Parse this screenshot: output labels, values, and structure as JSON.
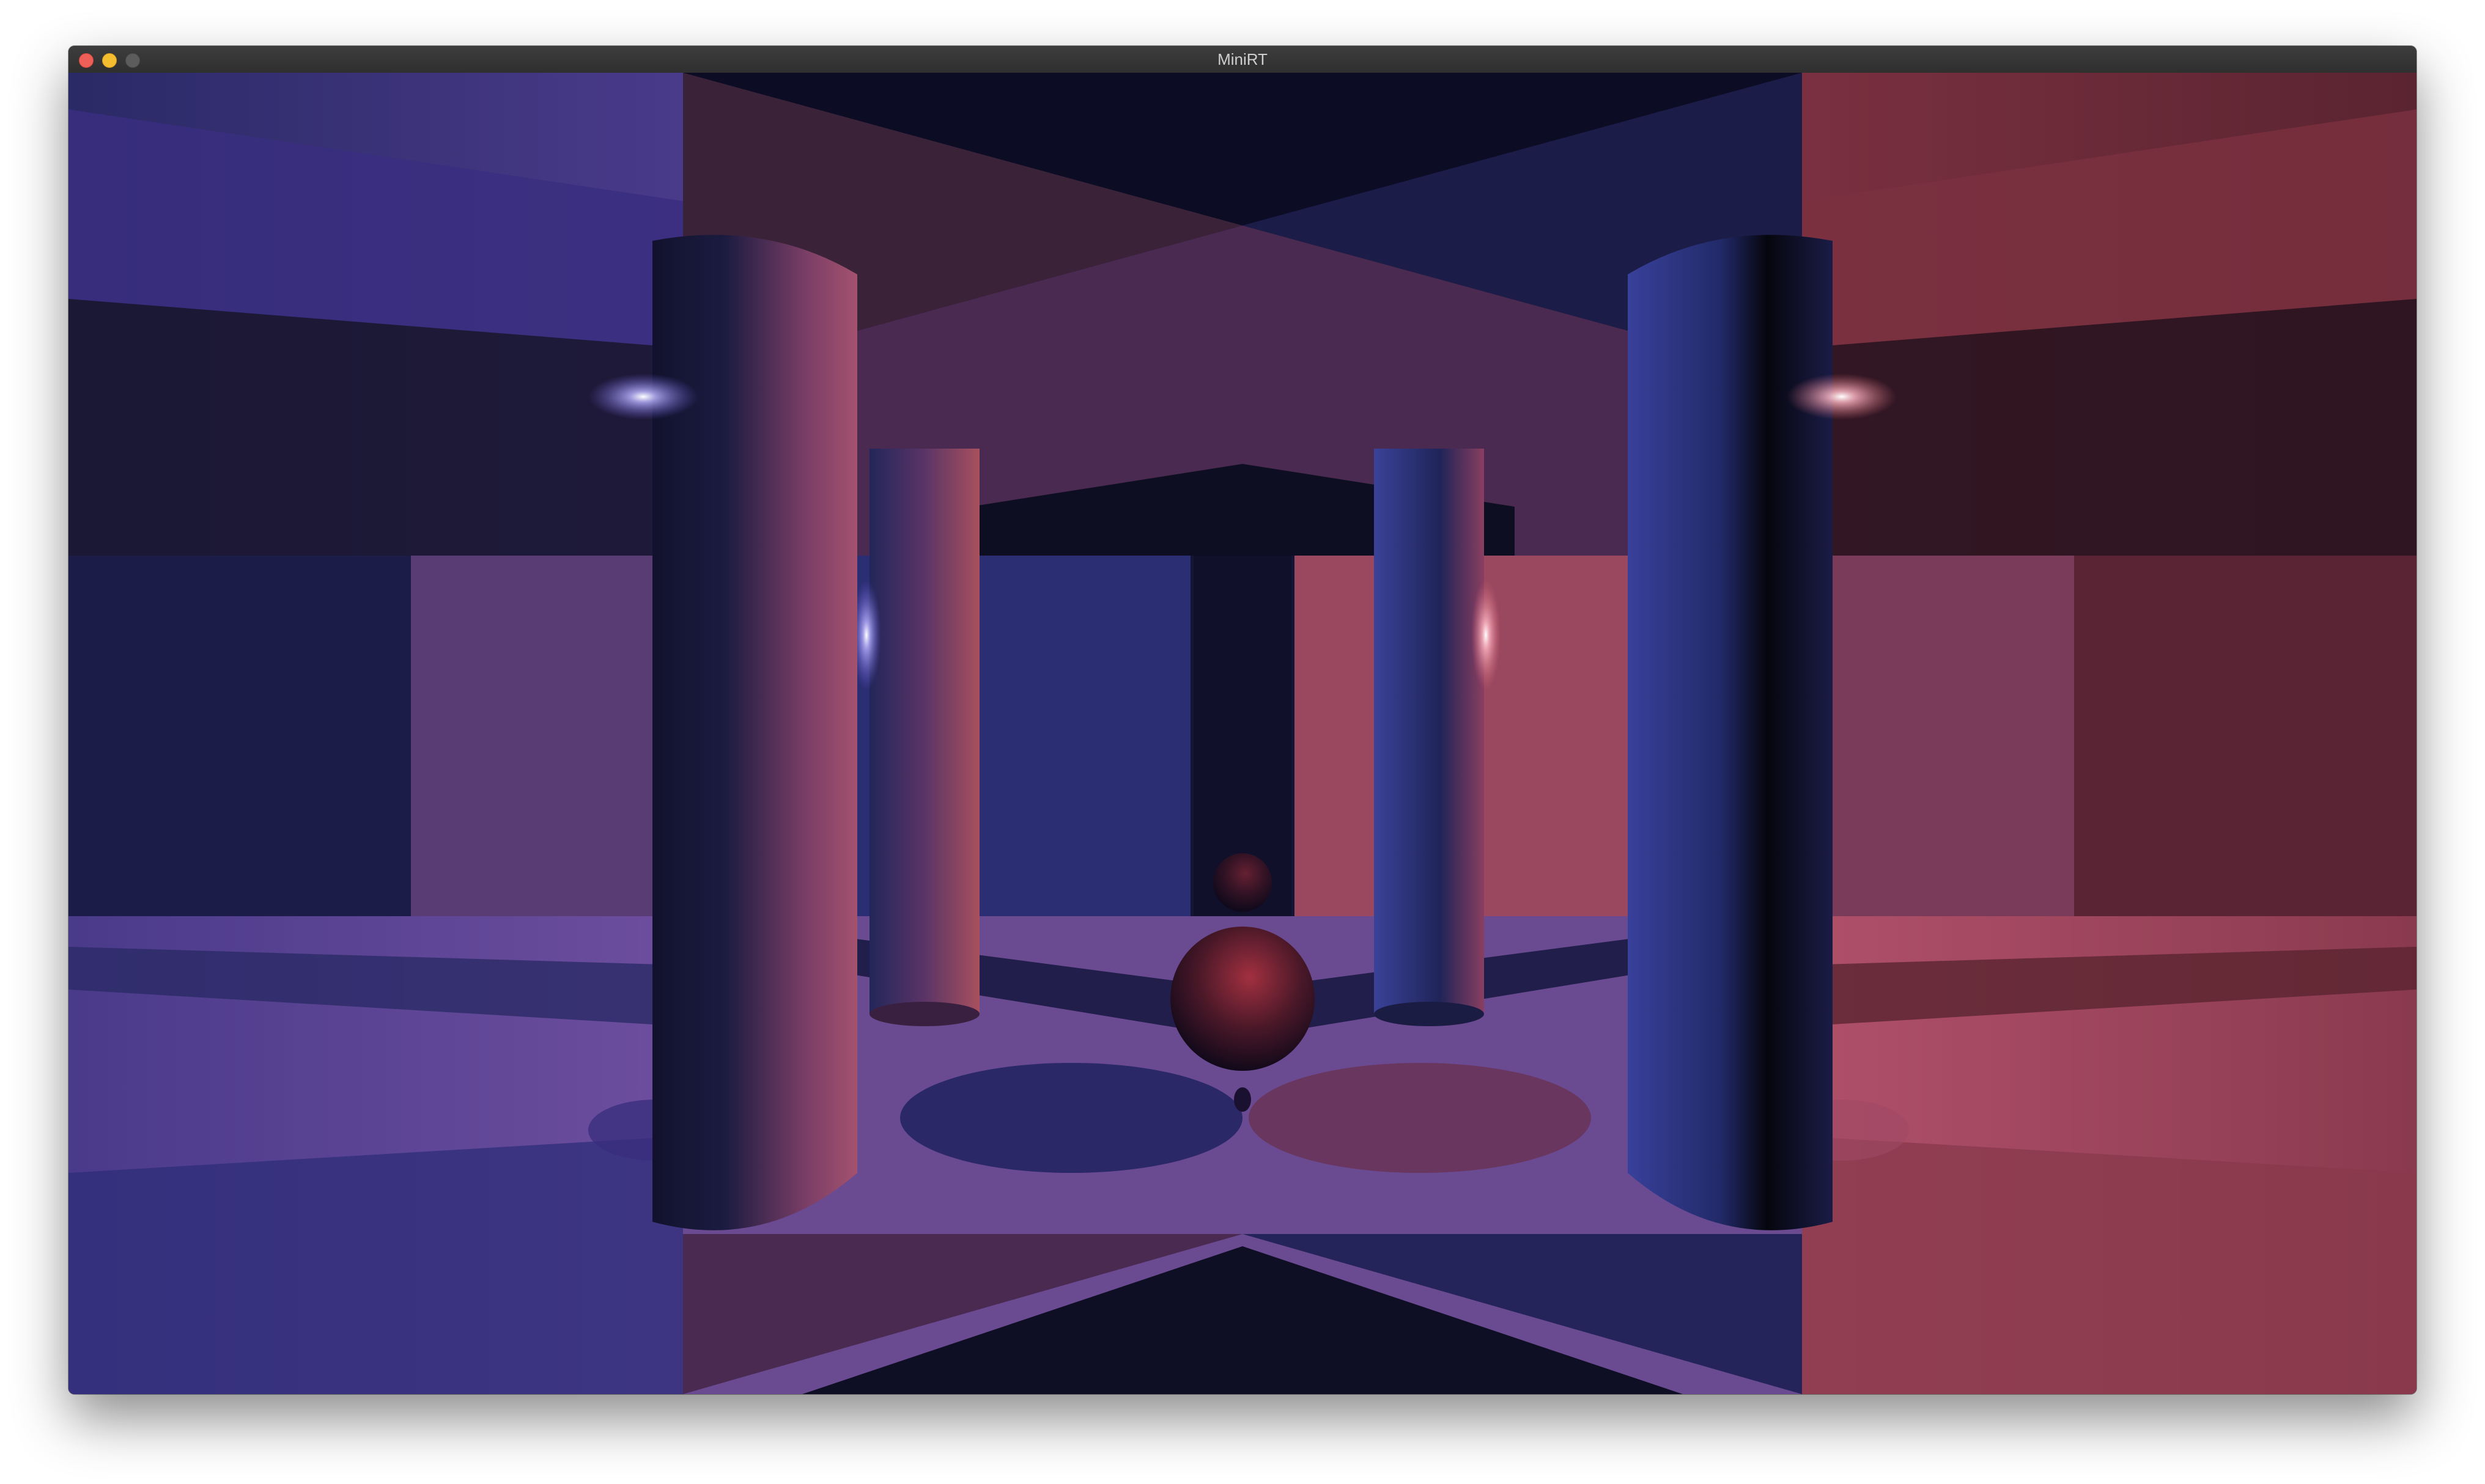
{
  "window": {
    "title": "MiniRT",
    "controls": [
      "close",
      "minimize",
      "zoom"
    ]
  },
  "scene": {
    "description_colors": {
      "blue_light": "#6a5ce0",
      "red_light": "#e06a7a",
      "deep_navy": "#0f1030",
      "purple": "#6e4e98",
      "rose": "#b0506a"
    }
  }
}
